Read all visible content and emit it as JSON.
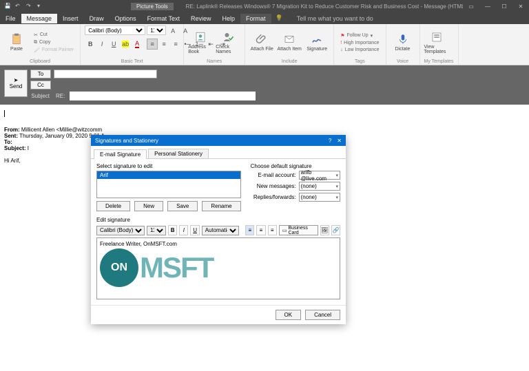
{
  "titlebar": {
    "context_group": "Picture Tools",
    "title": "RE: Laplink® Releases Windows® 7 Migration Kit to Reduce Customer Risk and Business Cost - Message (HTML)"
  },
  "tabs": {
    "file": "File",
    "message": "Message",
    "insert": "Insert",
    "draw": "Draw",
    "options": "Options",
    "format_text": "Format Text",
    "review": "Review",
    "help": "Help",
    "format": "Format",
    "tellme": "Tell me what you want to do"
  },
  "ribbon": {
    "clipboard": {
      "paste": "Paste",
      "cut": "Cut",
      "copy": "Copy",
      "format_painter": "Format Painter",
      "group": "Clipboard"
    },
    "basic_text": {
      "font": "Calibri (Body)",
      "size": "11",
      "group": "Basic Text"
    },
    "names": {
      "address_book": "Address Book",
      "check_names": "Check Names",
      "group": "Names"
    },
    "include": {
      "attach_file": "Attach File",
      "attach_item": "Attach Item",
      "signature": "Signature",
      "group": "Include"
    },
    "tags": {
      "follow_up": "Follow Up",
      "high": "High Importance",
      "low": "Low Importance",
      "group": "Tags"
    },
    "voice": {
      "dictate": "Dictate",
      "group": "Voice"
    },
    "templates": {
      "view": "View Templates",
      "group": "My Templates"
    }
  },
  "header": {
    "send": "Send",
    "to": "To",
    "cc": "Cc",
    "subject_label": "Subject",
    "subject_prefix": "RE:"
  },
  "body": {
    "from_label": "From:",
    "from_value": "Millicent Allen <Millie@witzcomm",
    "sent_label": "Sent:",
    "sent_value": "Thursday, January 09, 2020 9:01 A",
    "to_label": "To:",
    "subject_label": "Subject:",
    "subject_value": "I",
    "greeting": "Hi Arif,"
  },
  "dialog": {
    "title": "Signatures and Stationery",
    "tab_email": "E-mail Signature",
    "tab_stationery": "Personal Stationery",
    "select_label": "Select signature to edit",
    "list_item": "Arif",
    "choose_label": "Choose default signature",
    "account_label": "E-mail account:",
    "account_value": "arifb           @live.com",
    "newmsg_label": "New messages:",
    "newmsg_value": "(none)",
    "replies_label": "Replies/forwards:",
    "replies_value": "(none)",
    "btn_delete": "Delete",
    "btn_new": "New",
    "btn_save": "Save",
    "btn_rename": "Rename",
    "edit_label": "Edit signature",
    "font": "Calibri (Body)",
    "size": "11",
    "auto": "Automatic",
    "bcard": "Business Card",
    "sig_text": "Freelance Writer, OnMSFT.com",
    "logo_on": "ON",
    "logo_msft": "MSFT",
    "ok": "OK",
    "cancel": "Cancel"
  }
}
